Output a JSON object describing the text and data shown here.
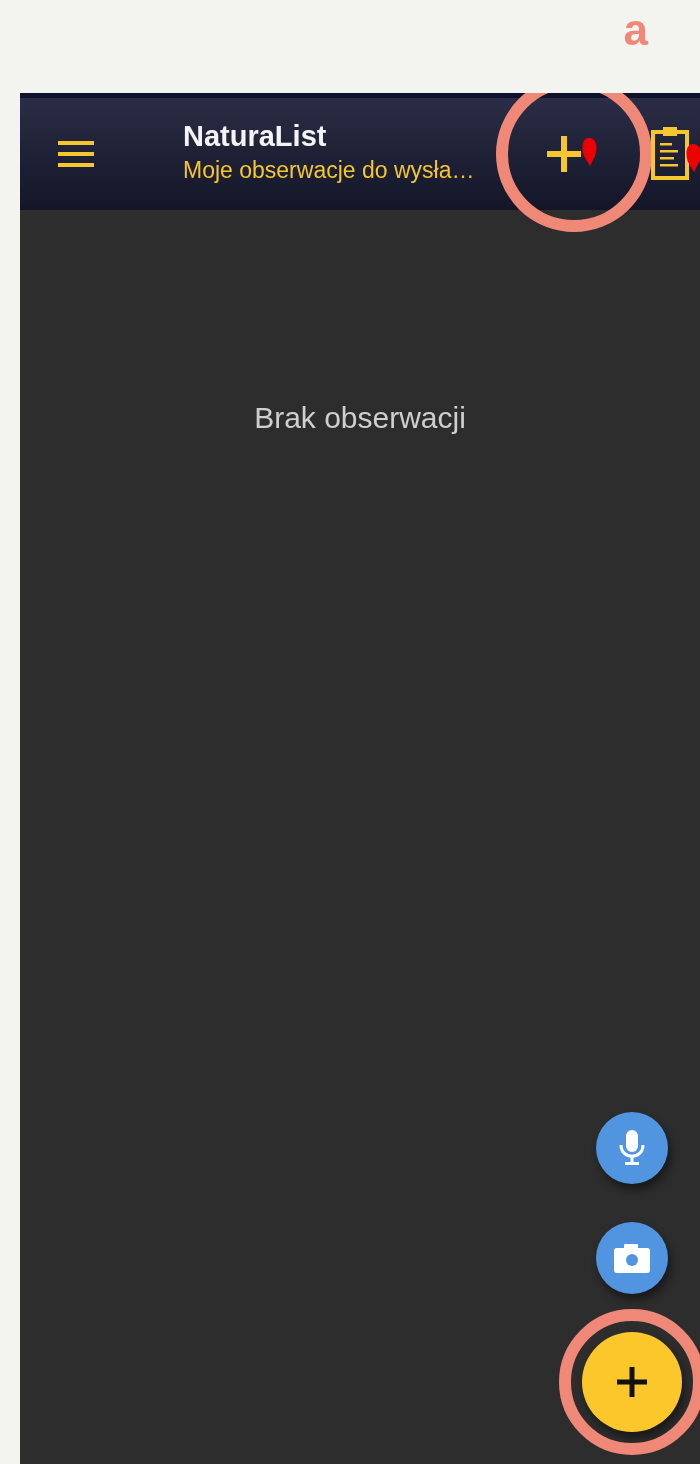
{
  "annotation_label": "a",
  "app_bar": {
    "title": "NaturaList",
    "subtitle": "Moje obserwacje do wysła…",
    "actions": [
      {
        "kind": "add_marker",
        "highlighted": true
      },
      {
        "kind": "clipboard_marker",
        "highlighted": false
      }
    ]
  },
  "empty_message": "Brak obserwacji",
  "fabs": [
    {
      "kind": "microphone",
      "highlighted": false
    },
    {
      "kind": "camera",
      "highlighted": false
    },
    {
      "kind": "add",
      "highlighted": true
    }
  ]
}
